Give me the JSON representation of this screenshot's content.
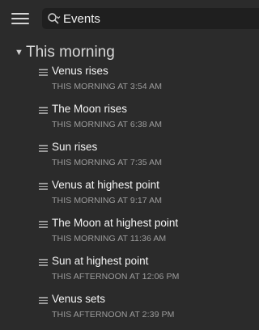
{
  "toolbar": {
    "menu_icon": "hamburger-menu-icon",
    "search_icon": "magnifier-with-dropdown-icon",
    "search_value": "Events"
  },
  "section": {
    "title": "This morning",
    "expanded": true,
    "disclosure_icon": "triangle-down-icon"
  },
  "events": [
    {
      "title": "Venus rises",
      "time": "THIS MORNING AT 3:54 AM"
    },
    {
      "title": "The Moon rises",
      "time": "THIS MORNING AT 6:38 AM"
    },
    {
      "title": "Sun rises",
      "time": "THIS MORNING AT 7:35 AM"
    },
    {
      "title": "Venus at highest point",
      "time": "THIS MORNING AT 9:17 AM"
    },
    {
      "title": "The Moon at highest point",
      "time": "THIS MORNING AT 11:36 AM"
    },
    {
      "title": "Sun at highest point",
      "time": "THIS AFTERNOON AT 12:06 PM"
    },
    {
      "title": "Venus sets",
      "time": "THIS AFTERNOON AT 2:39 PM"
    }
  ],
  "colors": {
    "background": "#2b2b2b",
    "search_background": "#1f1f1f",
    "title_text": "#f5f5f5",
    "subtitle_text": "#9d9d9d"
  }
}
